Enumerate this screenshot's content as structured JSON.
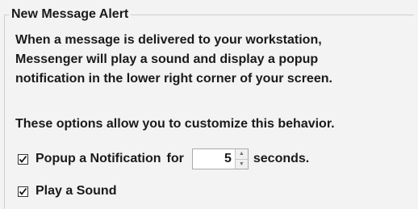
{
  "group": {
    "title": "New Message Alert"
  },
  "description": {
    "lines": [
      "When a message is delivered to your workstation,",
      "Messenger will play a sound and display a popup",
      "notification in the lower right corner of your screen."
    ]
  },
  "options_intro": "These options allow you to customize this behavior.",
  "popup_option": {
    "checked": true,
    "label": "Popup a Notification",
    "for_label": "for",
    "seconds_value": "5",
    "seconds_label": "seconds.",
    "icons": {
      "increment": "spin-up-icon",
      "decrement": "spin-down-icon"
    }
  },
  "sound_option": {
    "checked": true,
    "label": "Play a Sound"
  }
}
